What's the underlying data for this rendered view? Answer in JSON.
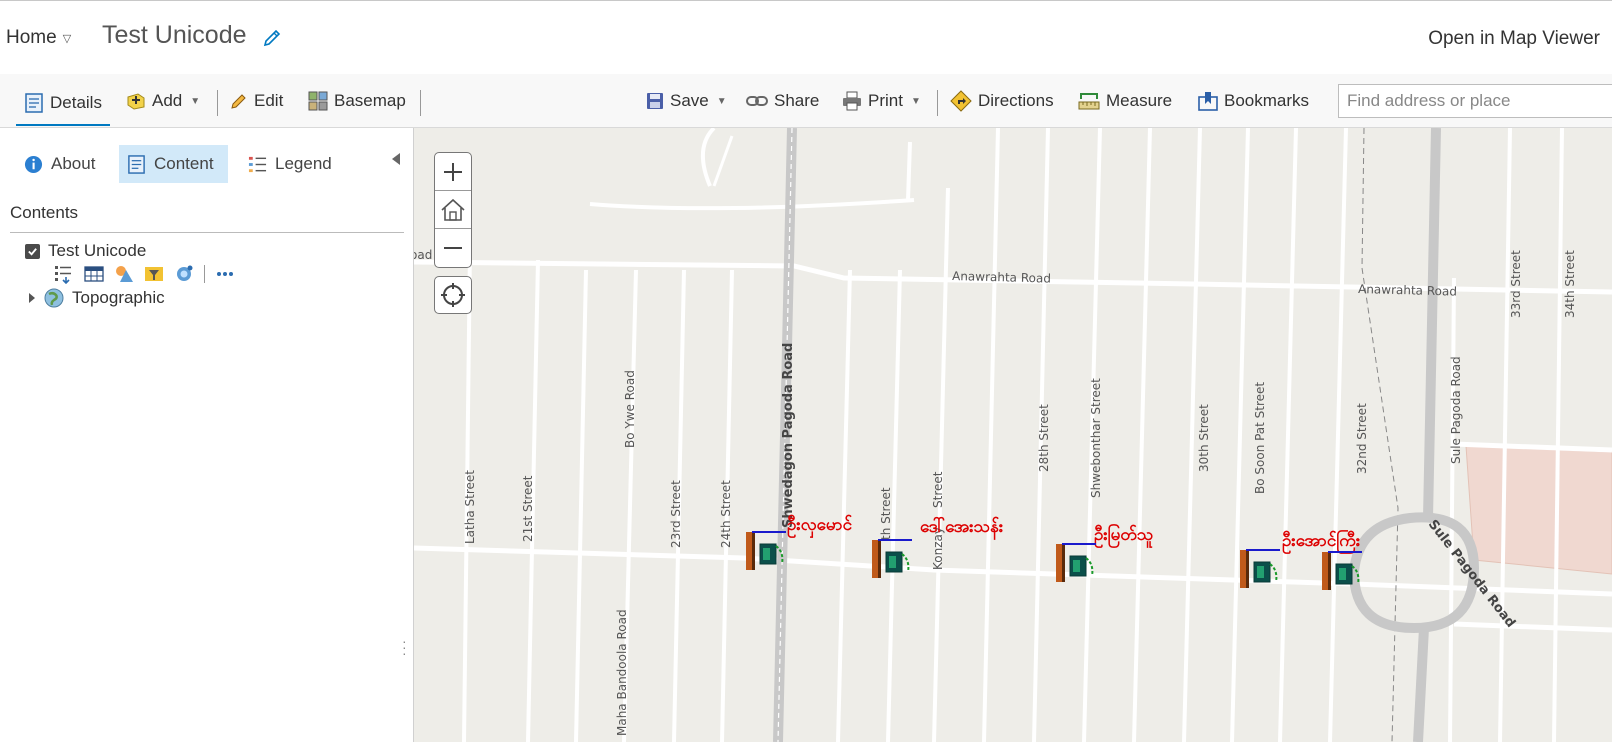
{
  "header": {
    "home_label": "Home",
    "title": "Test Unicode",
    "open_viewer_label": "Open in Map Viewer"
  },
  "toolbar": {
    "details": "Details",
    "add": "Add",
    "edit": "Edit",
    "basemap": "Basemap",
    "save": "Save",
    "share": "Share",
    "print": "Print",
    "directions": "Directions",
    "measure": "Measure",
    "bookmarks": "Bookmarks",
    "search_placeholder": "Find address or place"
  },
  "sidebar": {
    "tabs": [
      {
        "label": "About",
        "icon": "info-icon"
      },
      {
        "label": "Content",
        "icon": "content-icon",
        "active": true
      },
      {
        "label": "Legend",
        "icon": "legend-icon"
      }
    ],
    "contents_heading": "Contents",
    "layers": [
      {
        "name": "Test Unicode",
        "checked": true
      },
      {
        "name": "Topographic",
        "expandable": true
      }
    ]
  },
  "map": {
    "streets": {
      "road_partial": "oad",
      "anawrahta_1": "Anawrahta Road",
      "anawrahta_2": "Anawrahta Road",
      "latha": "Latha Street",
      "st21": "21st Street",
      "bo_ywe": "Bo Ywe Road",
      "st23": "23rd Street",
      "st24": "24th Street",
      "shwedagon": "Shwedagon Pagoda Road",
      "th_street": "th Street",
      "konzay": "Konzay",
      "konzay_suffix": "Street",
      "st28": "28th Street",
      "shwebonthar": "Shwebonthar Street",
      "st30": "30th Street",
      "bo_soon_pat": "Bo Soon Pat Street",
      "st32": "32nd Street",
      "sule_vertical": "Sule Pagoda Road",
      "sule_curved": "Sule Pagoda Road",
      "st33": "33rd Street",
      "st34": "34th Street",
      "maha_bandoola": "Maha Bandoola Road"
    },
    "points": [
      {
        "label": "ဦးလှမောင်"
      },
      {
        "label": "ဒေါ်အေးသန်း"
      },
      {
        "label": "ဦးမြတ်သူ"
      },
      {
        "label": "ဦးအောင်ကြီး"
      }
    ],
    "colors": {
      "label_red": "#dd0000",
      "road_white": "#ffffff",
      "major_road": "#c8c8c8",
      "land": "#eeede8",
      "building": "#f0d8d0",
      "accent_blue": "#0079c1"
    }
  }
}
